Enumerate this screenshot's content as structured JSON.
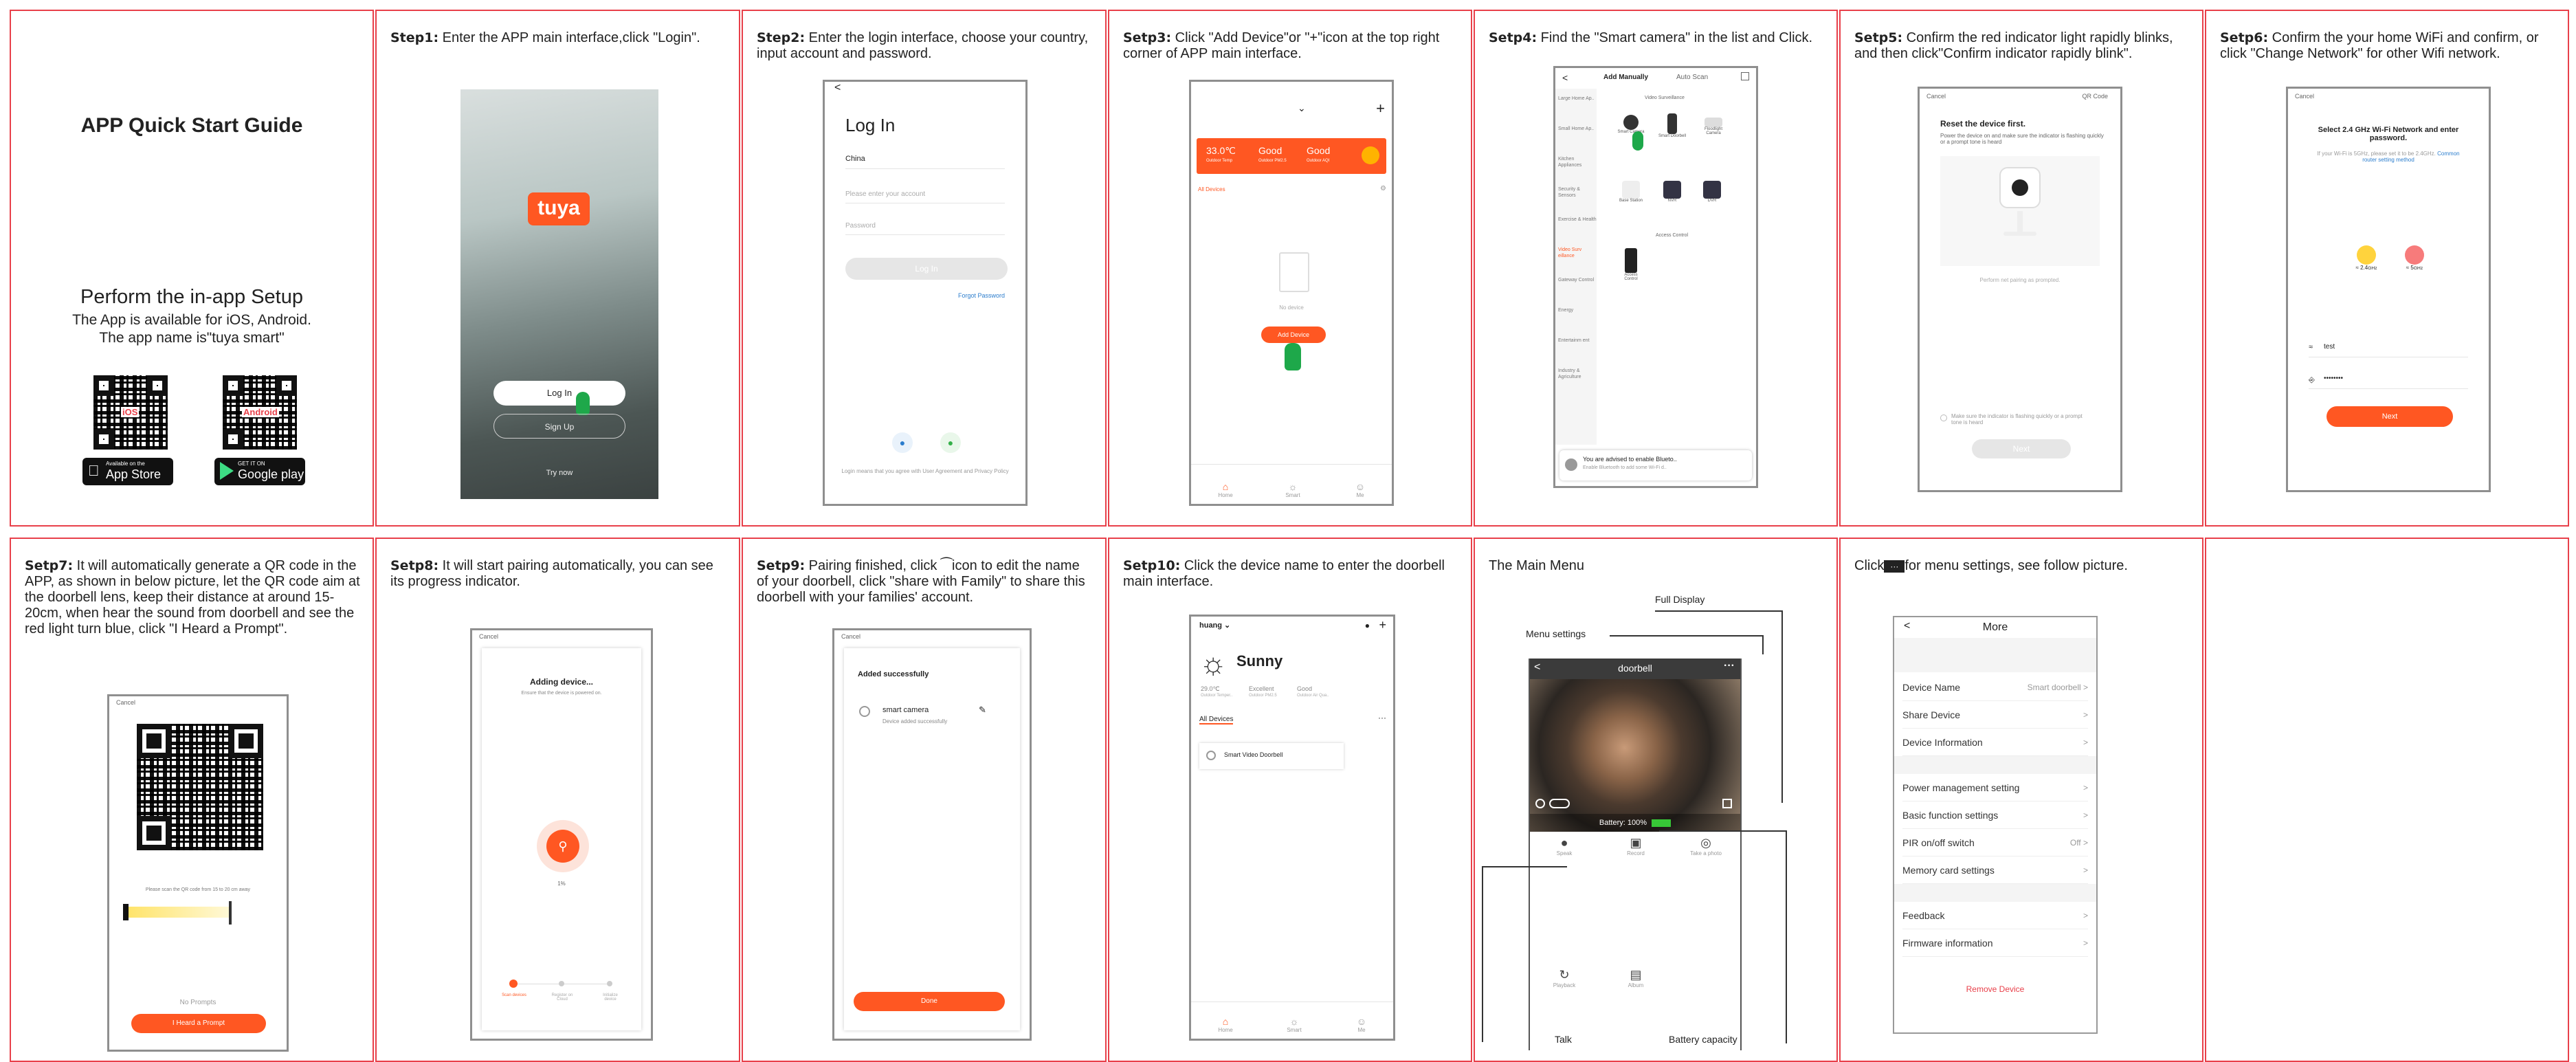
{
  "guide": {
    "title": "APP Quick Start Guide",
    "setup_heading": "Perform the in-app Setup",
    "setup_line1": "The App is available for iOS, Android.",
    "setup_line2": "The app name is\"tuya smart\"",
    "ios_badge_small": "Available on the",
    "ios_badge": "App Store",
    "android_badge_small": "GET IT ON",
    "android_badge": "Google play",
    "qr_ios_label": "iOS",
    "qr_android_label": "Android"
  },
  "steps": [
    {
      "tag": "Step1:",
      "text": " Enter the APP main interface,click \"Login\"."
    },
    {
      "tag": "Step2:",
      "text": " Enter the login interface, choose your country, input account and password."
    },
    {
      "tag": "Setp3:",
      "text": " Click \"Add Device\"or \"+\"icon at the top right corner of APP main interface."
    },
    {
      "tag": "Setp4:",
      "text": " Find the \"Smart camera\" in the list and Click."
    },
    {
      "tag": "Setp5:",
      "text": " Confirm the red indicator light rapidly blinks, and then click\"Confirm indicator rapidly blink\"."
    },
    {
      "tag": "Setp6:",
      "text": " Confirm the your home WiFi and confirm, or click \"Change Network\" for other Wifi network."
    },
    {
      "tag": "Setp7:",
      "text": " It will automatically generate a QR code in the APP, as shown in below picture, let the QR code aim at the doorbell lens, keep their distance at around 15-20cm, when hear the sound from doorbell and see the red light turn blue, click \"I Heard a Prompt\"."
    },
    {
      "tag": "Setp8:",
      "text": " It will start pairing automatically, you can see its progress indicator."
    },
    {
      "tag": "Setp9:",
      "text": " Pairing finished, click ⁀icon to edit the name of your doorbell, click \"share with Family\" to share this doorbell with your families' account."
    },
    {
      "tag": "Setp10:",
      "text": " Click the device name to enter the doorbell main interface."
    }
  ],
  "s1": {
    "logo": "tuya",
    "login": "Log In",
    "signup": "Sign Up",
    "trynow": "Try now"
  },
  "s2": {
    "back": "<",
    "title": "Log In",
    "country": "China",
    "account_ph": "Please enter your account",
    "password_ph": "Password",
    "button": "Log In",
    "forgot": "Forgot Password",
    "terms": "Login means that you agree with  User Agreement  and Privacy Policy"
  },
  "s3": {
    "plus": "+",
    "chev": "⌄",
    "temp": "33.0℃",
    "temp_l": "Outdoor Temp",
    "pm": "Good",
    "pm_l": "Outdoor PM2.5",
    "air": "Good",
    "air_l": "Outdoor AQI",
    "tab": "All Devices",
    "nodev": "No device",
    "add": "Add Device",
    "nav1": "Home",
    "nav2": "Smart",
    "nav3": "Me"
  },
  "s4": {
    "tab1": "Add Manually",
    "tab2": "Auto Scan",
    "cats": [
      "Large Home Ap..",
      "Small Home Ap..",
      "Kitchen Appliances",
      "Security & Sensors",
      "Exercise & Health",
      "Video Surv eillance",
      "Gateway Control",
      "Energy",
      "Entertainm ent",
      "Industry & Agriculture"
    ],
    "section1": "Video Surveillance",
    "section2": "Access Control",
    "dev1": "Smart Camera",
    "dev2": "Smart Doorbell",
    "dev3": "Floodlight Camera",
    "dev4": "Base Station",
    "dev5": "NVR",
    "dev6": "DVR",
    "dev7": "Access Control",
    "bt": "You are advised to enable Blueto..",
    "bt2": "Enable Bluetooth to add some Wi-Fi d.."
  },
  "s5": {
    "cancel": "Cancel",
    "mode": "QR Code",
    "title": "Reset the device first.",
    "desc": "Power the device on and make sure the indicator is flashing quickly or a prompt tone is heard",
    "link": "Perform net pairing as prompted.",
    "check": "Make sure the indicator is flashing quickly or a prompt tone is heard",
    "next": "Next"
  },
  "s6": {
    "cancel": "Cancel",
    "title": "Select 2.4 GHz Wi-Fi Network and enter password.",
    "desc": "If your Wi-Fi is 5GHz, please set it to be 2.4GHz.",
    "link": "Common router setting method",
    "g24": "2.4",
    "g5": "5",
    "ssid": "test",
    "pwd": "••••••••",
    "next": "Next"
  },
  "s7": {
    "cancel": "Cancel",
    "hint": "Please scan the QR code from 15 to 20 cm away",
    "noprompt": "No Prompts",
    "heard": "I Heard a Prompt"
  },
  "s8": {
    "cancel": "Cancel",
    "title": "Adding device...",
    "desc": "Ensure that the device is powered on.",
    "pct": "1%",
    "st1": "Scan devices",
    "st2": "Register on Cloud",
    "st3": "Initialize device"
  },
  "s9": {
    "cancel": "Cancel",
    "title": "Added successfully",
    "name": "smart camera",
    "sub": "Device added successfully",
    "done": "Done"
  },
  "s10": {
    "home": "huang",
    "weather": "Sunny",
    "t1": "29.0℃",
    "t1l": "Outdoor Temper..",
    "t2": "Excellent",
    "t2l": "Outdoor PM2.5",
    "t3": "Good",
    "t3l": "Outdoor Air Qua..",
    "tab": "All Devices",
    "device": "Smart Video Doorbell",
    "nav1": "Home",
    "nav2": "Smart",
    "nav3": "Me"
  },
  "mainmenu": {
    "heading": "The Main Menu",
    "full": "Full Display",
    "menu": "Menu settings",
    "talk": "Talk",
    "battery": "Battery capacity",
    "title": "doorbell",
    "battery_text": "Battery: 100%",
    "speak": "Speak",
    "record": "Record",
    "photo": "Take a photo",
    "playback": "Playback",
    "album": "Album"
  },
  "more": {
    "heading": "for menu settings, see follow picture.",
    "heading_pre": "Click",
    "title": "More",
    "back": "<",
    "rows": [
      {
        "label": "Device Name",
        "value": "Smart doorbell >"
      },
      {
        "label": "Share Device",
        "value": ">"
      },
      {
        "label": "Device Information",
        "value": ">"
      },
      {
        "label": "Power management setting",
        "value": ">"
      },
      {
        "label": "Basic function settings",
        "value": ">"
      },
      {
        "label": "PIR on/off switch",
        "value": "Off >"
      },
      {
        "label": "Memory card settings",
        "value": ">"
      },
      {
        "label": "Feedback",
        "value": ">"
      },
      {
        "label": "Firmware information",
        "value": ">"
      }
    ],
    "remove": "Remove Device"
  },
  "colors": {
    "accent": "#ff5722",
    "border": "#e8404a",
    "arrow": "#555555"
  }
}
